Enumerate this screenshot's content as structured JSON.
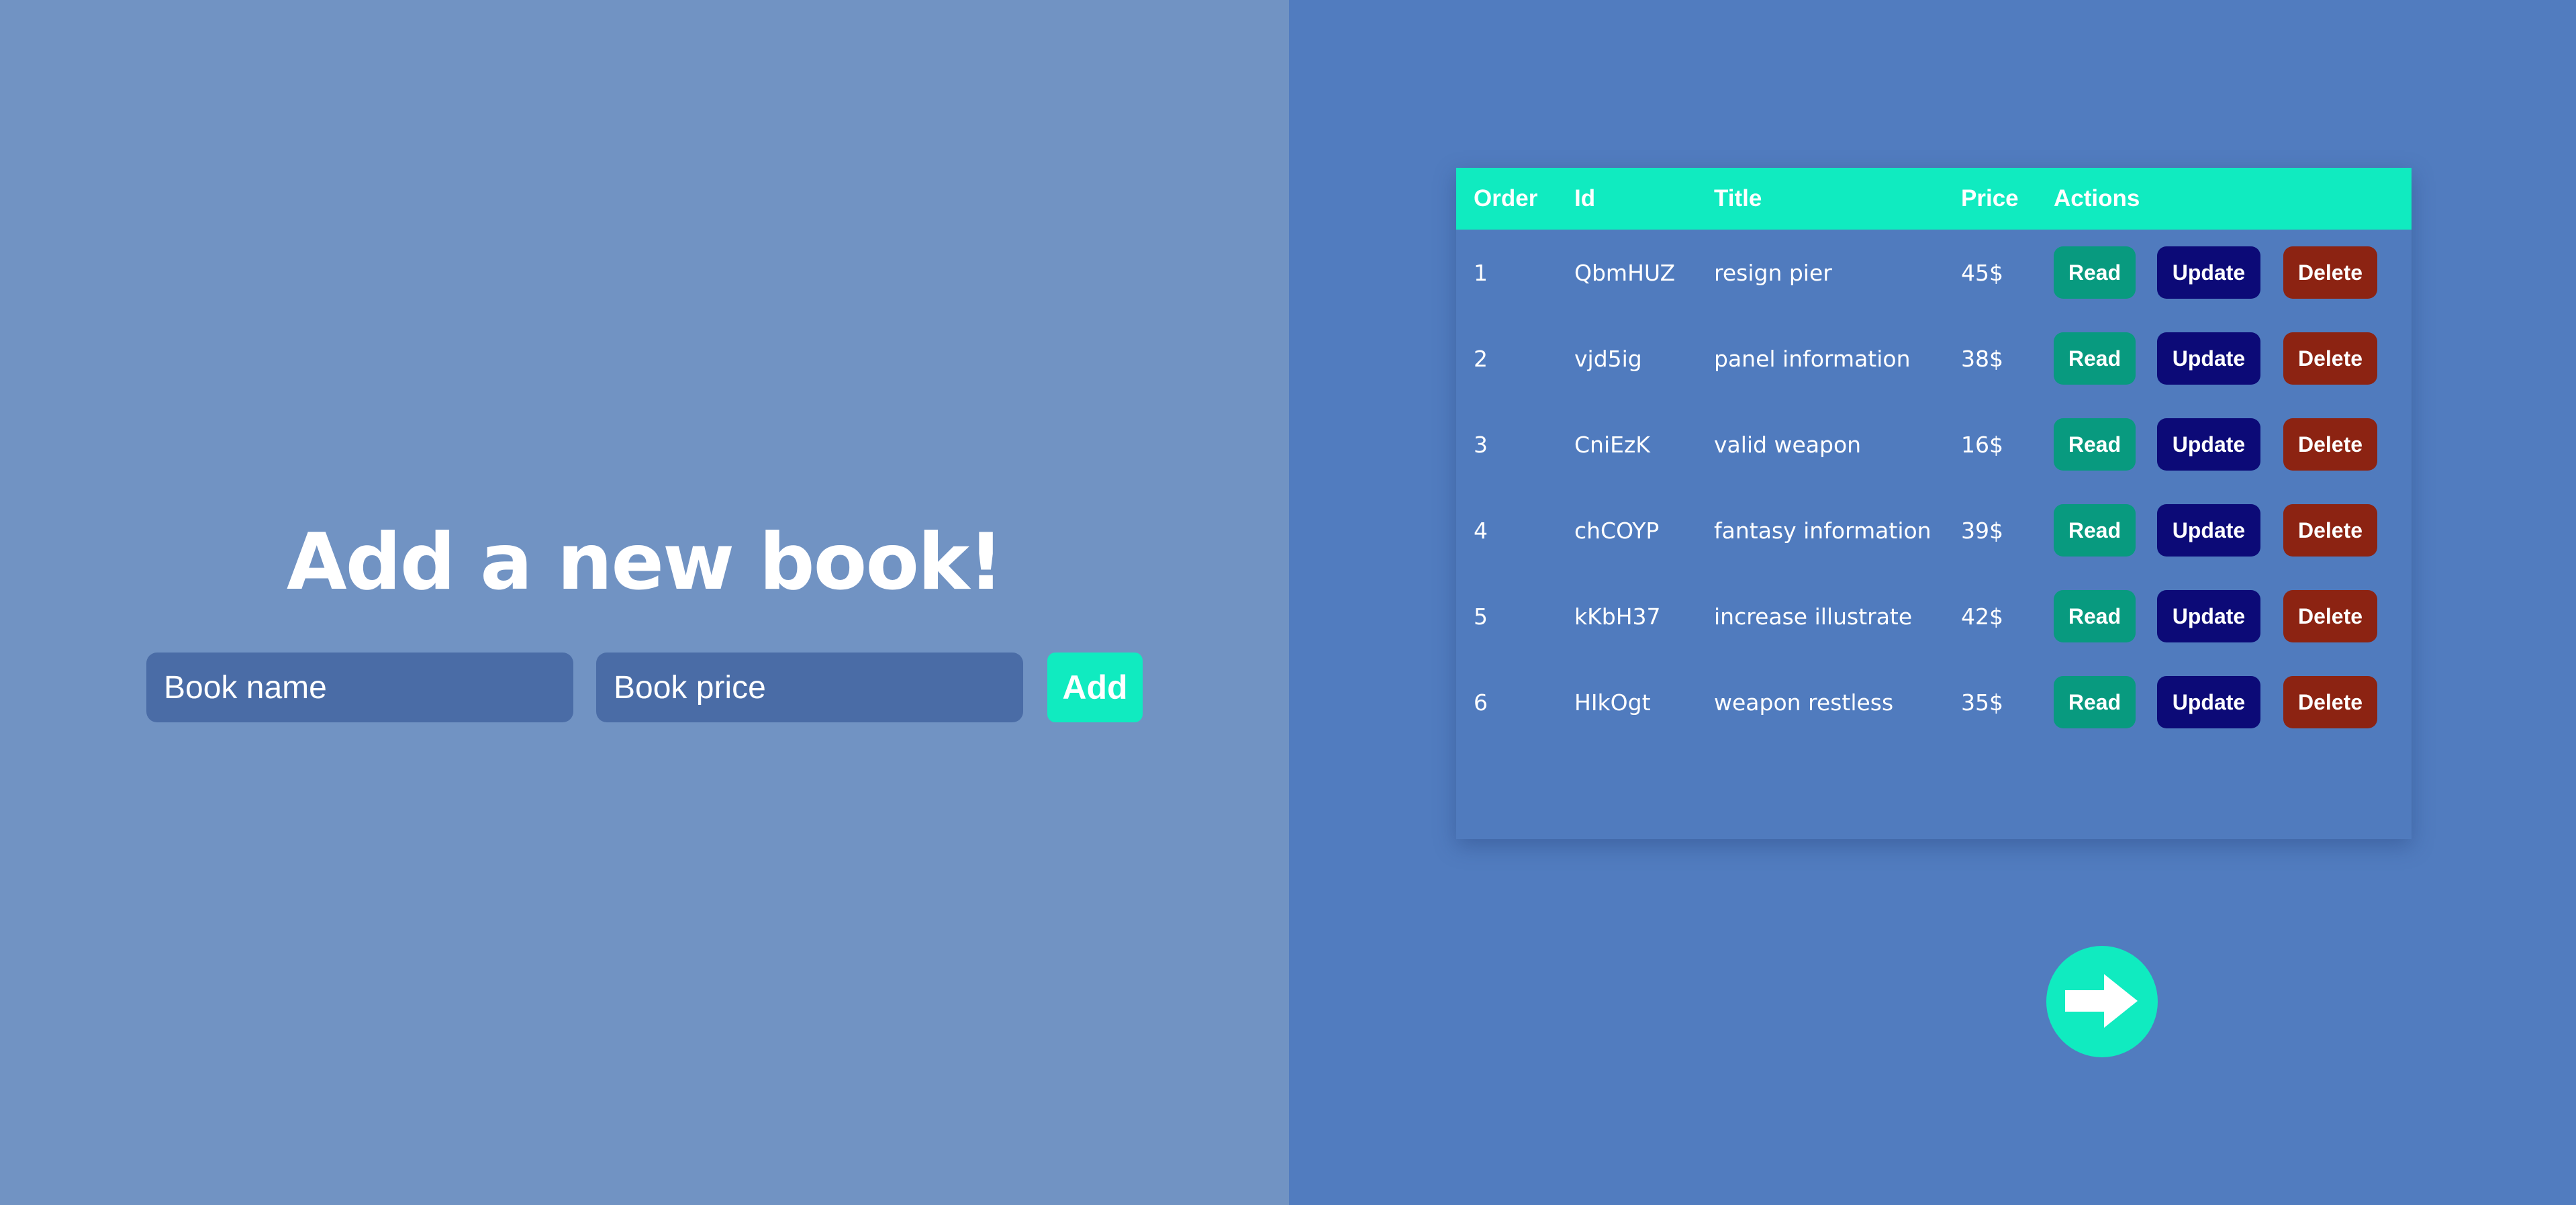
{
  "form": {
    "title": "Add a new book!",
    "name_placeholder": "Book name",
    "name_value": "",
    "price_placeholder": "Book price",
    "price_value": "",
    "add_label": "Add"
  },
  "table": {
    "headers": {
      "order": "Order",
      "id": "Id",
      "title": "Title",
      "price": "Price",
      "actions": "Actions"
    },
    "rows": [
      {
        "order": "1",
        "id": "QbmHUZ",
        "title": "resign pier",
        "price": "45$"
      },
      {
        "order": "2",
        "id": "vjd5ig",
        "title": "panel information",
        "price": "38$"
      },
      {
        "order": "3",
        "id": "CniEzK",
        "title": "valid weapon",
        "price": "16$"
      },
      {
        "order": "4",
        "id": "chCOYP",
        "title": "fantasy information",
        "price": "39$"
      },
      {
        "order": "5",
        "id": "kKbH37",
        "title": "increase illustrate",
        "price": "42$"
      },
      {
        "order": "6",
        "id": "HIkOgt",
        "title": "weapon restless",
        "price": "35$"
      }
    ],
    "read_label": "Read",
    "update_label": "Update",
    "delete_label": "Delete"
  },
  "pagination": {
    "next_icon": "arrow-right-icon"
  },
  "colors": {
    "left_background": "#7193c3",
    "right_background": "#517cbf",
    "accent": "#10ebc0",
    "read": "#089a7f",
    "update": "#0c0a77",
    "delete": "#8c2312",
    "input_background": "#4a6ca6"
  }
}
